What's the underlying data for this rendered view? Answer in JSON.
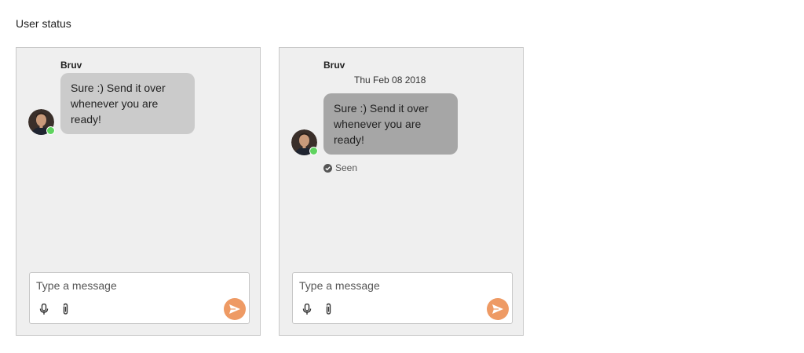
{
  "page": {
    "heading": "User status"
  },
  "colors": {
    "send_button": "#ee9a64",
    "online_status": "#5fd35f",
    "bubble_light": "#cbcbcb",
    "bubble_dark": "#a6a6a6",
    "panel_background": "#efefef"
  },
  "panels": [
    {
      "author": "Bruv",
      "message": "Sure :) Send it over whenever you are ready!",
      "avatar_icon": "user-avatar",
      "status": "online",
      "composer": {
        "placeholder": "Type a message",
        "value": "",
        "icons": [
          "microphone-icon",
          "paperclip-icon",
          "send-icon"
        ]
      }
    },
    {
      "author": "Bruv",
      "date": "Thu Feb 08 2018",
      "message": "Sure :) Send it over whenever you are ready!",
      "avatar_icon": "user-avatar",
      "status": "online",
      "seen_label": "Seen",
      "composer": {
        "placeholder": "Type a message",
        "value": "",
        "icons": [
          "microphone-icon",
          "paperclip-icon",
          "send-icon"
        ]
      }
    }
  ]
}
